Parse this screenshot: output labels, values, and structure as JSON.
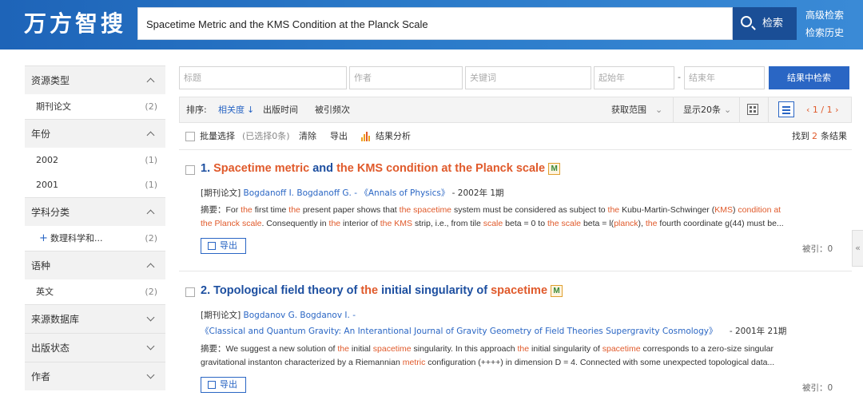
{
  "header": {
    "logo": "万方智搜",
    "search_value": "Spacetime Metric and the KMS Condition at the Planck Scale",
    "search_button": "检索",
    "advanced_search": "高级检索",
    "search_history": "检索历史"
  },
  "sidebar": {
    "facets": [
      {
        "title": "资源类型",
        "expanded": true,
        "items": [
          {
            "label": "期刊论文",
            "count": "(2)"
          }
        ]
      },
      {
        "title": "年份",
        "expanded": true,
        "items": [
          {
            "label": "2002",
            "count": "(1)"
          },
          {
            "label": "2001",
            "count": "(1)"
          }
        ]
      },
      {
        "title": "学科分类",
        "expanded": true,
        "items": [
          {
            "label": "数理科学和...",
            "count": "(2)"
          }
        ]
      },
      {
        "title": "语种",
        "expanded": true,
        "items": [
          {
            "label": "英文",
            "count": "(2)"
          }
        ]
      },
      {
        "title": "来源数据库",
        "expanded": false,
        "items": []
      },
      {
        "title": "出版状态",
        "expanded": false,
        "items": []
      },
      {
        "title": "作者",
        "expanded": false,
        "items": []
      }
    ]
  },
  "filters": {
    "title_placeholder": "标题",
    "author_placeholder": "作者",
    "keyword_placeholder": "关键词",
    "start_year_placeholder": "起始年",
    "end_year_placeholder": "结束年",
    "dash": "-",
    "search_in_results": "结果中检索"
  },
  "sortbar": {
    "label": "排序:",
    "relevance": "相关度",
    "relevance_arrow": "↓",
    "pub_time": "出版时间",
    "cited": "被引频次",
    "scope": "获取范围",
    "per_page": "显示20条",
    "pager": "‹ 1 / 1 ›"
  },
  "batchbar": {
    "batch_select": "批量选择",
    "selected": "(已选择0条)",
    "clear": "清除",
    "export": "导出",
    "analysis": "结果分析",
    "found_prefix": "找到",
    "found_count": "2",
    "found_suffix": "条结果"
  },
  "results": [
    {
      "title_parts": [
        "1. ",
        "Spacetime metric",
        " and ",
        "the KMS condition at the Planck scale"
      ],
      "badge": "M",
      "type": "[期刊论文]",
      "authors": "Bogdanoff I.  Bogdanoff G.",
      "journal_sep": "-",
      "journal": "《Annals of Physics》",
      "date": "- 2002年 1期",
      "abstract_line1": "摘要：For the first time the present paper shows that the spacetime system must be considered as subject to the Kubu-Martin-Schwinger (KMS) condition at",
      "abstract_line2": "the Planck scale. Consequently in the interior of the KMS strip, i.e., from tile scale beta = 0 to the scale beta = l(planck), the fourth coordinate g(44) must be...",
      "export": "导出",
      "cited": "被引：0"
    },
    {
      "title_parts": [
        "2. Topological field theory of ",
        "the",
        " initial singularity of ",
        "spacetime"
      ],
      "badge": "M",
      "type": "[期刊论文]",
      "authors": "Bogdanov G.  Bogdanov I.",
      "journal_sep": "-",
      "journal": "《Classical and Quantum Gravity: An Interantional Journal of Gravity Geometry of Field Theories Supergravity Cosmology》",
      "date": "- 2001年 21期",
      "abstract_line1": "摘要：We suggest a new solution of the initial spacetime singularity. In this approach the initial singularity of spacetime corresponds to a zero-size singular",
      "abstract_line2": "gravitational instanton characterized by a Riemannian metric configuration (++++) in dimension D = 4. Connected with some unexpected topological data...",
      "export": "导出",
      "cited": "被引：0"
    }
  ],
  "collapse_label": "«",
  "colors": {
    "primary": "#2a66c4",
    "highlight": "#e05a2b",
    "title": "#1d4fa0"
  }
}
